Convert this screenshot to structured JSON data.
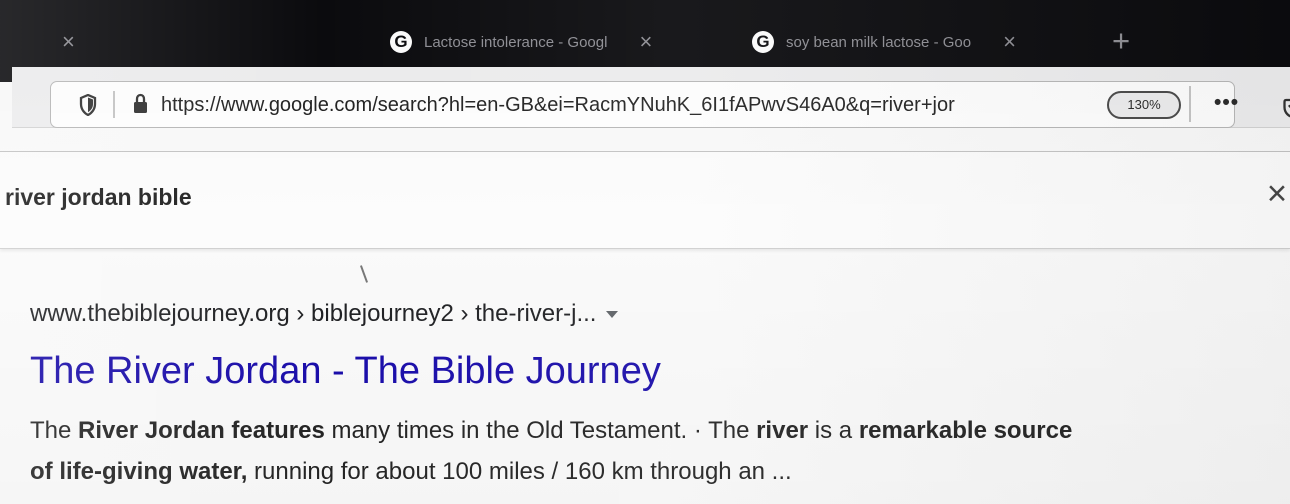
{
  "browser": {
    "tabs": [
      {
        "title": "",
        "favicon": ""
      },
      {
        "title": "Lactose intolerance - Googl",
        "favicon": "G"
      },
      {
        "title": "soy bean milk lactose - Goo",
        "favicon": "G"
      }
    ],
    "address": {
      "url": "https://www.google.com/search?hl=en-GB&ei=RacmYNuhK_6I1fAPwvS46A0&q=river+jor",
      "zoom": "130%"
    }
  },
  "search": {
    "query": "river jordan bible"
  },
  "result": {
    "domain": "www.thebiblejourney.org",
    "path": " › biblejourney2 › the-river-j...",
    "title": "The River Jordan - The Bible Journey",
    "snippet": {
      "part1": "The ",
      "bold1": "River Jordan",
      "part2": " ",
      "bold2": "features",
      "part3": " many times in the Old Testament. · The ",
      "bold3": "river",
      "part4": " is a ",
      "bold4": "remarkable source",
      "bold5": "of life-giving water,",
      "part5": " running for about 100 miles / 160 km through an ..."
    }
  },
  "colors": {
    "tab_bar": "#0b0b0e",
    "link": "#1a0dab",
    "text": "#202124"
  },
  "icons": {
    "shield": "shield-icon",
    "lock": "lock-icon",
    "more": "more-icon",
    "pocket": "pocket-icon",
    "close": "close-icon",
    "new_tab": "plus-icon",
    "dropdown": "caret-down-icon"
  }
}
